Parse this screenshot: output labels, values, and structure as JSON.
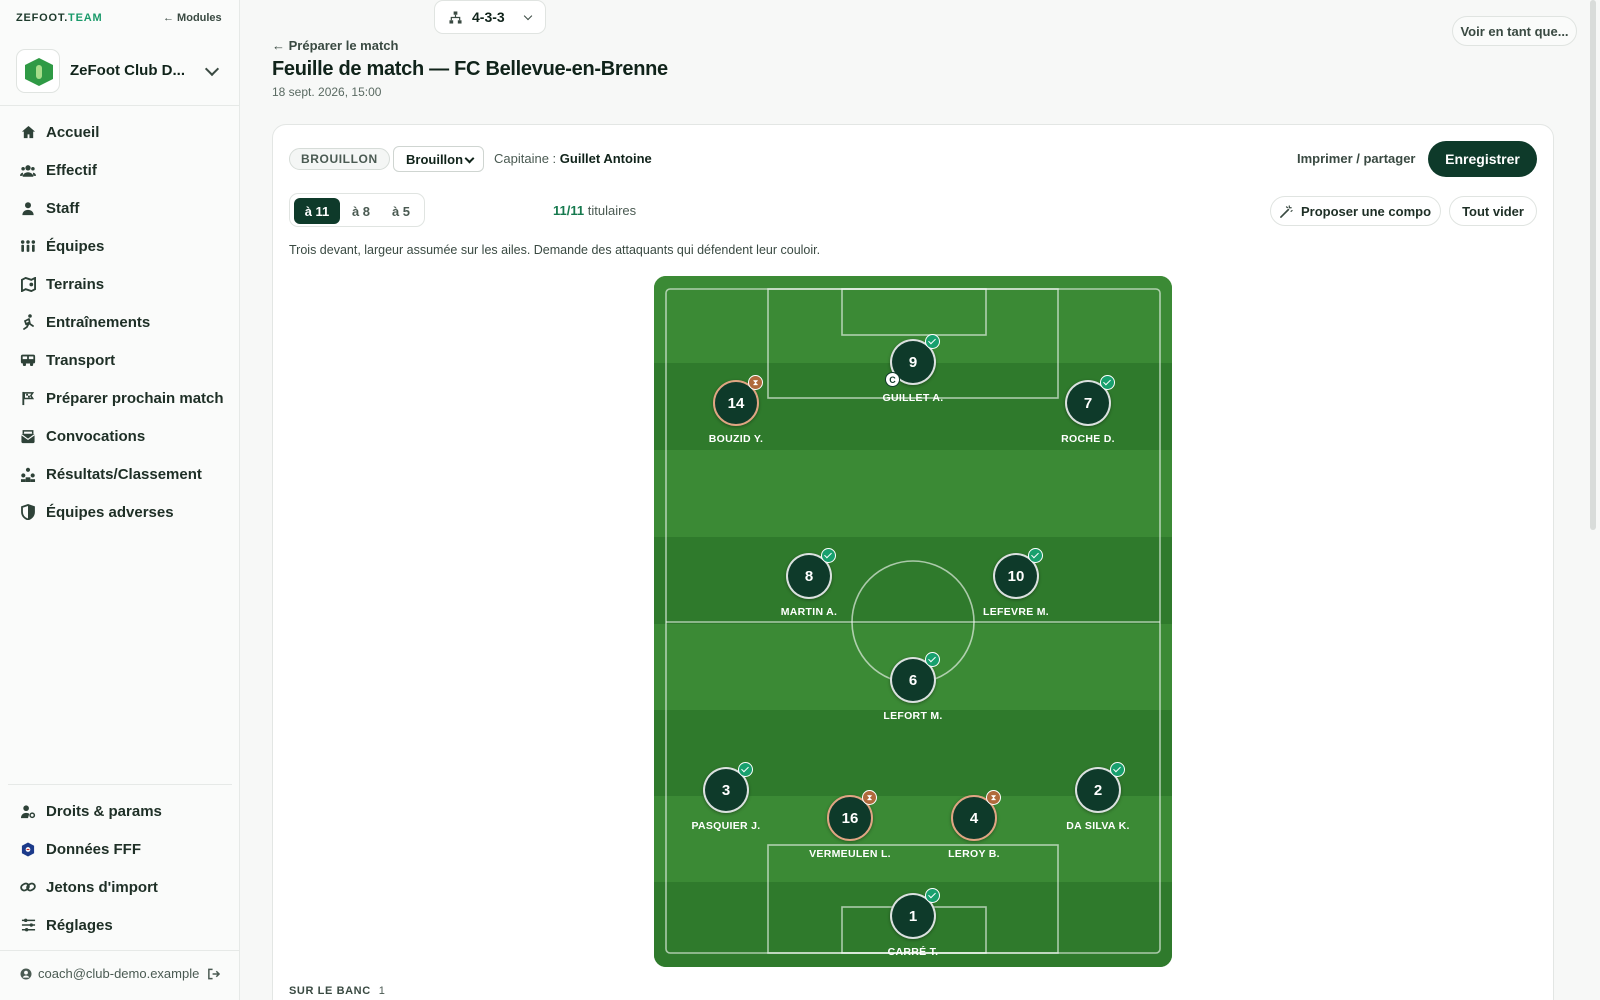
{
  "app": {
    "brand_main": "ZEFOOT.",
    "brand_accent": "TEAM",
    "modules_label": "← Modules",
    "club_name": "ZeFoot Club D..."
  },
  "sidebar": {
    "items": [
      {
        "label": "Accueil",
        "icon": "home-icon"
      },
      {
        "label": "Effectif",
        "icon": "people-icon"
      },
      {
        "label": "Staff",
        "icon": "person-icon"
      },
      {
        "label": "Équipes",
        "icon": "team-icon"
      },
      {
        "label": "Terrains",
        "icon": "field-map-icon"
      },
      {
        "label": "Entraînements",
        "icon": "running-icon"
      },
      {
        "label": "Transport",
        "icon": "bus-icon"
      },
      {
        "label": "Préparer prochain match",
        "icon": "flag-icon"
      },
      {
        "label": "Convocations",
        "icon": "envelope-icon"
      },
      {
        "label": "Résultats/Classement",
        "icon": "ranking-icon"
      },
      {
        "label": "Équipes adverses",
        "icon": "shield-icon"
      }
    ],
    "bottom_items": [
      {
        "label": "Droits & params",
        "icon": "user-settings-icon"
      },
      {
        "label": "Données FFF",
        "icon": "fff-logo-icon"
      },
      {
        "label": "Jetons d'import",
        "icon": "link-icon"
      },
      {
        "label": "Réglages",
        "icon": "sliders-icon"
      }
    ],
    "user_email": "coach@club-demo.example"
  },
  "header": {
    "back_link": "← Préparer le match",
    "title": "Feuille de match — FC Bellevue-en-Brenne",
    "date": "18 sept. 2026, 15:00",
    "view_as": "Voir en tant que..."
  },
  "toolbar": {
    "status_badge": "BROUILLON",
    "status_select": "Brouillon",
    "captain_label": "Capitaine :",
    "captain_name": "Guillet Antoine",
    "print_label": "Imprimer / partager",
    "save_label": "Enregistrer",
    "formats": [
      "à 11",
      "à 8",
      "à 5"
    ],
    "active_format": "à 11",
    "formation": "4-3-3",
    "starters_count": "11/11",
    "starters_label": "titulaires",
    "propose_label": "Proposer une compo",
    "clear_label": "Tout vider"
  },
  "formation_description": "Trois devant, largeur assumée sur les ailes. Demande des attaquants qui défendent leur couloir.",
  "players": [
    {
      "number": "9",
      "name": "GUILLET A.",
      "status": "confirmed",
      "captain": true,
      "captain_mark": "C"
    },
    {
      "number": "14",
      "name": "BOUZID Y.",
      "status": "pending"
    },
    {
      "number": "7",
      "name": "ROCHE D.",
      "status": "confirmed"
    },
    {
      "number": "8",
      "name": "MARTIN A.",
      "status": "confirmed"
    },
    {
      "number": "10",
      "name": "LEFEVRE M.",
      "status": "confirmed"
    },
    {
      "number": "6",
      "name": "LEFORT M.",
      "status": "confirmed"
    },
    {
      "number": "3",
      "name": "PASQUIER J.",
      "status": "confirmed"
    },
    {
      "number": "16",
      "name": "VERMEULEN L.",
      "status": "pending"
    },
    {
      "number": "4",
      "name": "LEROY B.",
      "status": "pending"
    },
    {
      "number": "2",
      "name": "DA SILVA K.",
      "status": "confirmed"
    },
    {
      "number": "1",
      "name": "CARRÉ T.",
      "status": "confirmed"
    }
  ],
  "bench": {
    "label": "SUR LE BANC",
    "count": "1"
  },
  "colors": {
    "primary": "#0e3a2a",
    "accent": "#1a9a6a",
    "pitch_dark": "#2f7a2c",
    "pitch_light": "#3b8a35",
    "confirmed": "#18a06e",
    "pending": "#b06a3c"
  }
}
